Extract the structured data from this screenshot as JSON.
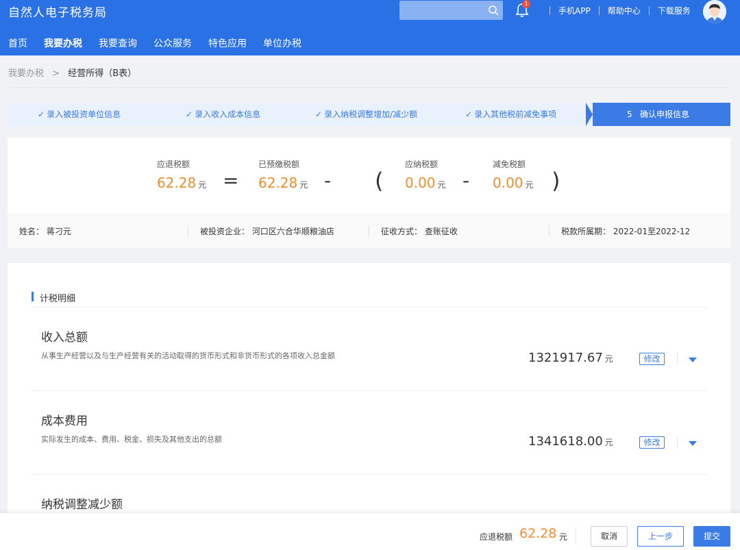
{
  "header": {
    "title": "自然人电子税务局",
    "notification_count": "1",
    "links": [
      "手机APP",
      "帮助中心",
      "下载服务"
    ],
    "nav": [
      "首页",
      "我要办税",
      "我要查询",
      "公众服务",
      "特色应用",
      "单位办税"
    ],
    "active_nav": "我要办税"
  },
  "breadcrumb": {
    "parent": "我要办税",
    "arrow": ">",
    "current": "经营所得（B表）"
  },
  "steps": [
    "录入被投资单位信息",
    "录入收入成本信息",
    "录入纳税调整增加/减少额",
    "录入其他税前减免事项"
  ],
  "active_step": {
    "number": "5",
    "label": "确认申报信息"
  },
  "summary": {
    "refund_label": "应退税额",
    "refund_value": "62.28",
    "prepaid_label": "已预缴税额",
    "prepaid_value": "62.28",
    "payable_label": "应纳税额",
    "payable_value": "0.00",
    "reduced_label": "减免税额",
    "reduced_value": "0.00",
    "unit": "元",
    "ops": {
      "eq": "=",
      "minus1": "-",
      "lparen": "(",
      "minus2": "-",
      "rparen": ")"
    }
  },
  "info": {
    "name": "姓名：  蒋刁元",
    "company": "被投资企业：  河口区六合华顺粮油店",
    "method": "征收方式：  查账征收",
    "period": "税款所属期：  2022-01至2022-12"
  },
  "detail": {
    "section_title": "计税明细",
    "items": [
      {
        "title": "收入总额",
        "desc": "从事生产经营以及与生产经营有关的活动取得的货币形式和非货币形式的各项收入总金额",
        "amount": "1321917.67",
        "edit": "修改"
      },
      {
        "title": "成本费用",
        "desc": "实际发生的成本、费用、税金、损失及其他支出的总额",
        "amount": "1341618.00",
        "edit": "修改"
      },
      {
        "title": "纳税调整减少额"
      }
    ],
    "unit": "元"
  },
  "bottom": {
    "label": "应退税额",
    "value": "62.28",
    "unit": "元",
    "cancel": "取消",
    "prev": "上一步",
    "submit": "提交"
  },
  "colors": {
    "primary": "#2b71e6",
    "accent": "#3a7be5",
    "amount": "#f08c2b"
  }
}
